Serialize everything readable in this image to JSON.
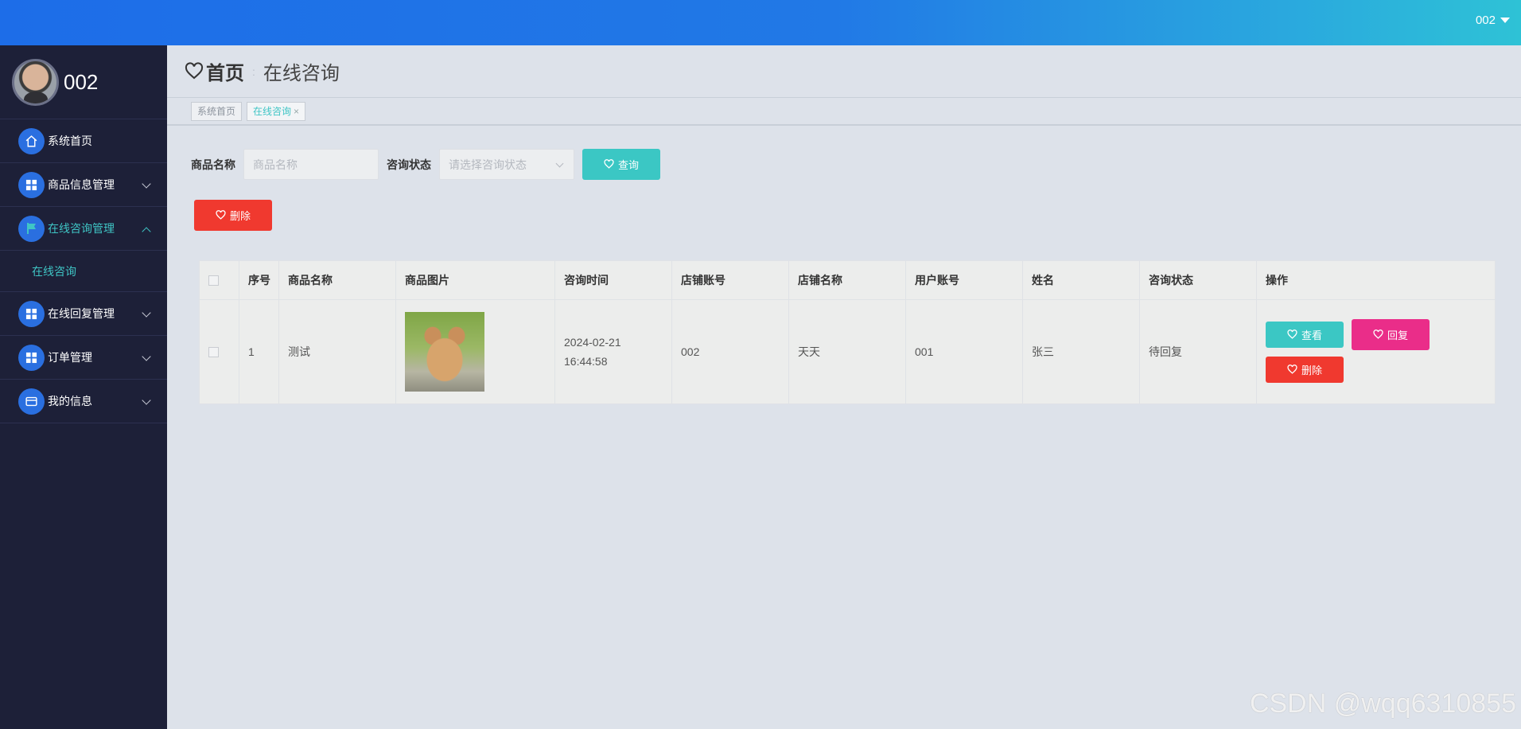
{
  "topbar": {
    "user": "002"
  },
  "sidebar": {
    "username": "002",
    "items": [
      {
        "label": "系统首页",
        "icon": "home-icon",
        "has_children": false
      },
      {
        "label": "商品信息管理",
        "icon": "grid-icon",
        "has_children": true
      },
      {
        "label": "在线咨询管理",
        "icon": "flag-icon",
        "has_children": true,
        "expanded": true,
        "children": [
          {
            "label": "在线咨询"
          }
        ]
      },
      {
        "label": "在线回复管理",
        "icon": "grid-icon",
        "has_children": true
      },
      {
        "label": "订单管理",
        "icon": "grid-icon",
        "has_children": true
      },
      {
        "label": "我的信息",
        "icon": "card-icon",
        "has_children": true
      }
    ]
  },
  "header": {
    "home": "首页",
    "current": "在线咨询"
  },
  "tabs": [
    {
      "label": "系统首页"
    },
    {
      "label": "在线咨询",
      "active": true,
      "close": "×"
    }
  ],
  "search": {
    "name_label": "商品名称",
    "name_placeholder": "商品名称",
    "status_label": "咨询状态",
    "status_placeholder": "请选择咨询状态",
    "query_button": "查询"
  },
  "actions": {
    "delete_button": "删除"
  },
  "table": {
    "columns": [
      "序号",
      "商品名称",
      "商品图片",
      "咨询时间",
      "店铺账号",
      "店铺名称",
      "用户账号",
      "姓名",
      "咨询状态",
      "操作"
    ],
    "rows": [
      {
        "index": "1",
        "product_name": "测试",
        "image": "rabbit-photo",
        "time": "2024-02-21 16:44:58",
        "shop_account": "002",
        "shop_name": "天天",
        "user_account": "001",
        "name": "张三",
        "status": "待回复",
        "ops": {
          "view": "查看",
          "reply": "回复",
          "delete": "删除"
        }
      }
    ]
  },
  "watermark": "CSDN @wqq6310855",
  "colors": {
    "accent": "#3bc7c4",
    "danger": "#f0392f",
    "pink": "#ea2d89",
    "sidebar_bg": "#1d2038",
    "topbar": "#1d6de8"
  }
}
